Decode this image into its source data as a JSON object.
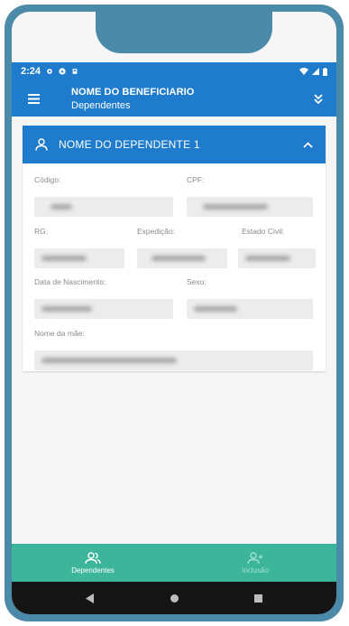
{
  "status_bar": {
    "time": "2:24"
  },
  "app_bar": {
    "title": "NOME DO BENEFICIARIO",
    "subtitle": "Dependentes"
  },
  "card": {
    "title": "NOME DO DEPENDENTE 1",
    "fields": {
      "codigo_label": "Código:",
      "cpf_label": "CPF:",
      "rg_label": "RG:",
      "expedicao_label": "Expedição:",
      "estado_civil_label": "Estado Civil:",
      "data_nascimento_label": "Data de Nascimento:",
      "sexo_label": "Sexo:",
      "nome_mae_label": "Nome da mãe:"
    }
  },
  "bottom_nav": {
    "items": [
      {
        "label": "Dependentes",
        "icon": "people-icon",
        "active": true
      },
      {
        "label": "Inclusão",
        "icon": "add-person-icon",
        "active": false
      }
    ]
  },
  "colors": {
    "primary": "#1f7ccc",
    "accent": "#3cb59b",
    "frame": "#4b8aa8"
  }
}
